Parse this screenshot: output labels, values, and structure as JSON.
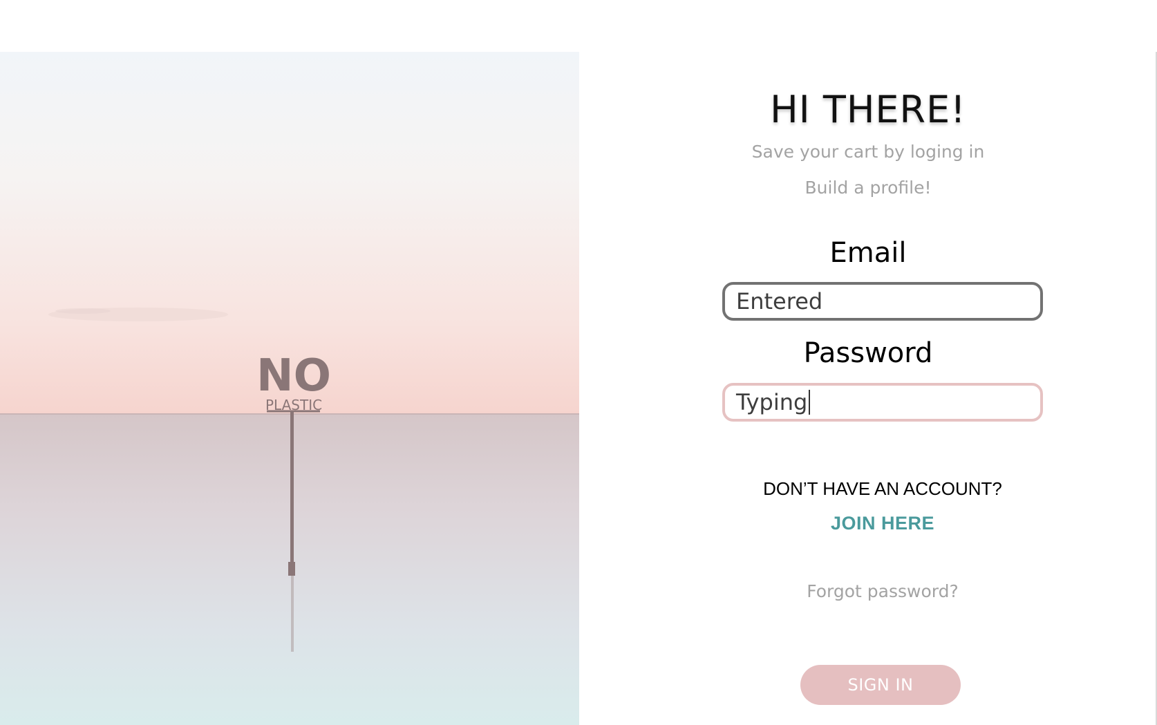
{
  "hero": {
    "sign_text": "NO",
    "sign_subtext": "PLASTIC"
  },
  "login": {
    "title": "HI THERE!",
    "subtitle_line1": "Save your cart by loging in",
    "subtitle_line2": "Build a profile!",
    "email_label": "Email",
    "email_value": "Entered",
    "password_label": "Password",
    "password_value": "Typing",
    "no_account_text": "DON’T HAVE AN ACCOUNT?",
    "join_link": "JOIN HERE",
    "forgot_link": "Forgot password?",
    "sign_in_button": "SIGN IN"
  },
  "colors": {
    "accent_teal": "#4a9a9c",
    "button_pink": "#e5bfc0",
    "focus_border_pink": "#e6c2c2",
    "muted_text": "#a3a3a3",
    "input_border_gray": "#727272"
  }
}
